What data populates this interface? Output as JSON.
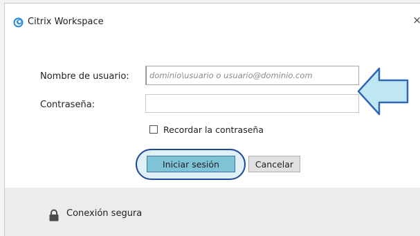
{
  "window": {
    "title": "Citrix Workspace",
    "close_glyph": "×"
  },
  "form": {
    "username_label": "Nombre de usuario:",
    "username_placeholder": "dominio\\usuario o usuario@dominio.com",
    "username_value": "",
    "password_label": "Contraseña:",
    "password_value": "",
    "remember_label": "Recordar la contraseña",
    "remember_checked": false
  },
  "buttons": {
    "login_label": "Iniciar sesión",
    "cancel_label": "Cancelar"
  },
  "footer": {
    "secure_label": "Conexión segura"
  },
  "colors": {
    "primary_button": "#7fc3d7",
    "highlight_ring": "#20489a",
    "arrow_fill": "#bfe6f3",
    "arrow_stroke": "#2d66b5"
  },
  "icons": {
    "app_logo": "citrix-logo-icon",
    "lock": "lock-icon",
    "close": "close-icon",
    "arrow": "left-arrow-icon"
  }
}
